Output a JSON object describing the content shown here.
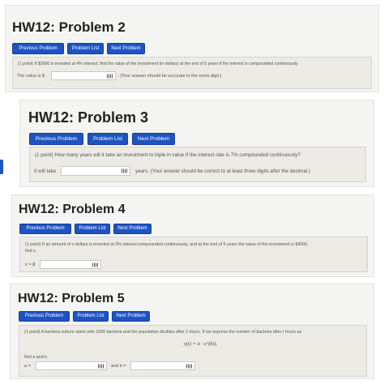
{
  "nav": {
    "prev": "Previous Problem",
    "list": "Problem List",
    "next": "Next Problem"
  },
  "problems": [
    {
      "title": "HW12: Problem 2",
      "question": "(1 point) If $3000 is invested at 4% interest, find the value of the investment (in dollars) at the end of 5 years if the interest is compounded continuously.",
      "answer_prefix": "The value is $",
      "answer_suffix": ". (Your answer should be accurate to the cents digit.)"
    },
    {
      "title": "HW12: Problem 3",
      "question": "(1 point) How many years will it take an investment to triple in value if the interest rate is 7% compounded continuously?",
      "answer_prefix": "It will take",
      "answer_suffix": "years. (Your answer should be correct to at least three digits after the decimal.)"
    },
    {
      "title": "HW12: Problem 4",
      "question_line1": "(1 point) If an amount of x dollars is invested at 3% interest compounded continuously, and at the end of 5 years the value of the investment is $4000,",
      "question_line2": "find x.",
      "answer_prefix": "x = $"
    },
    {
      "title": "HW12: Problem 5",
      "question": "(1 point) A bacteria culture starts with 1000 bacteria and the population doubles after 2 hours. If we express the number of bacteria after t hours as",
      "equation": "y(t) = a · e^(kt),",
      "find": "find a and k.",
      "a_label": "a =",
      "k_label": "and k ="
    }
  ],
  "colors": {
    "button": "#1f53c2",
    "panel": "#f4f4f2",
    "question_box": "#eceae4"
  }
}
